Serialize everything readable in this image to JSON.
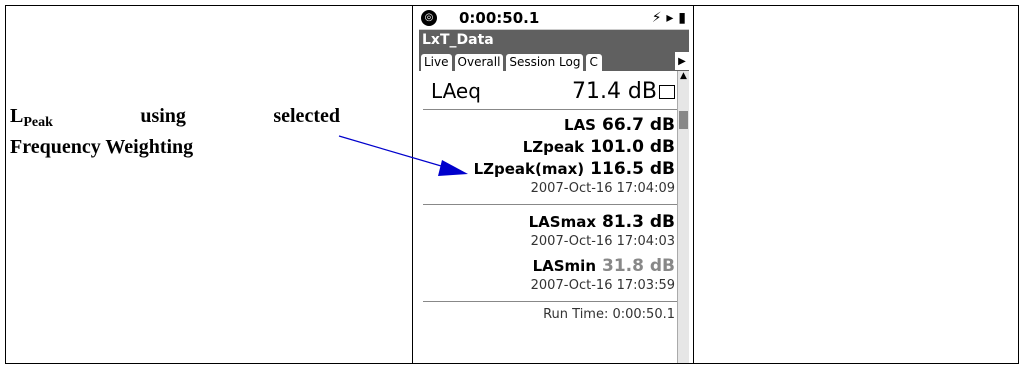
{
  "caption": {
    "l_main": "L",
    "l_sub": "Peak",
    "word_using": "using",
    "word_selected": "selected",
    "line2": "Frequency Weighting"
  },
  "device": {
    "status": {
      "time": "0:00:50.1",
      "icons": "⚡ ▸ ▮"
    },
    "title": "LxT_Data",
    "tabs": [
      "Live",
      "Overall",
      "Session Log",
      "C"
    ],
    "active_tab": "Overall",
    "laeq": {
      "label": "LAeq",
      "value": "71.4 dB"
    },
    "las": {
      "label": "LAS",
      "value": "66.7 dB"
    },
    "lzpeak": {
      "label": "LZpeak",
      "value": "101.0 dB"
    },
    "lzpeak_max": {
      "label": "LZpeak(max)",
      "value": "116.5 dB",
      "date": "2007-Oct-16 17:04:09"
    },
    "lasmax": {
      "label": "LASmax",
      "value": "81.3 dB",
      "date": "2007-Oct-16 17:04:03"
    },
    "lasmin": {
      "label": "LASmin",
      "value": "31.8 dB",
      "date": "2007-Oct-16 17:03:59"
    },
    "run_time": "Run Time: 0:00:50.1"
  },
  "colors": {
    "arrow": "#0000cc",
    "title_bar": "#606060"
  }
}
